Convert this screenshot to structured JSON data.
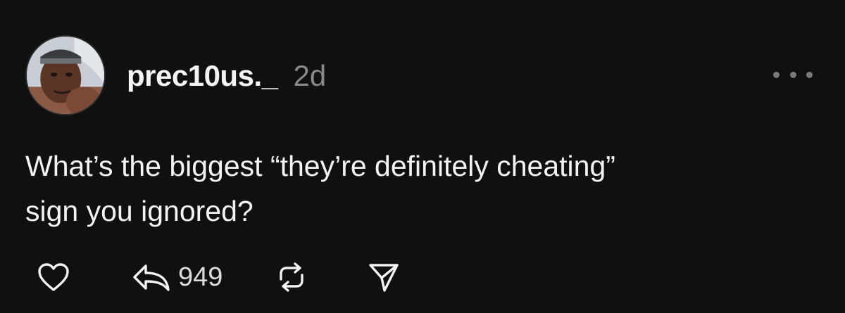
{
  "post": {
    "author": {
      "username": "prec10us._",
      "avatar_icon": "profile-photo"
    },
    "timestamp": "2d",
    "text_line1": "What’s the biggest “they’re definitely cheating”",
    "text_line2": "sign you ignored?",
    "actions": {
      "like_icon": "heart-icon",
      "reply_icon": "reply-icon",
      "reply_count": "949",
      "repost_icon": "repost-icon",
      "share_icon": "send-icon"
    },
    "more_icon": "ellipsis-icon"
  },
  "colors": {
    "background": "#101010",
    "primary_text": "#f3f3f3",
    "secondary_text": "#8a8a8a"
  }
}
